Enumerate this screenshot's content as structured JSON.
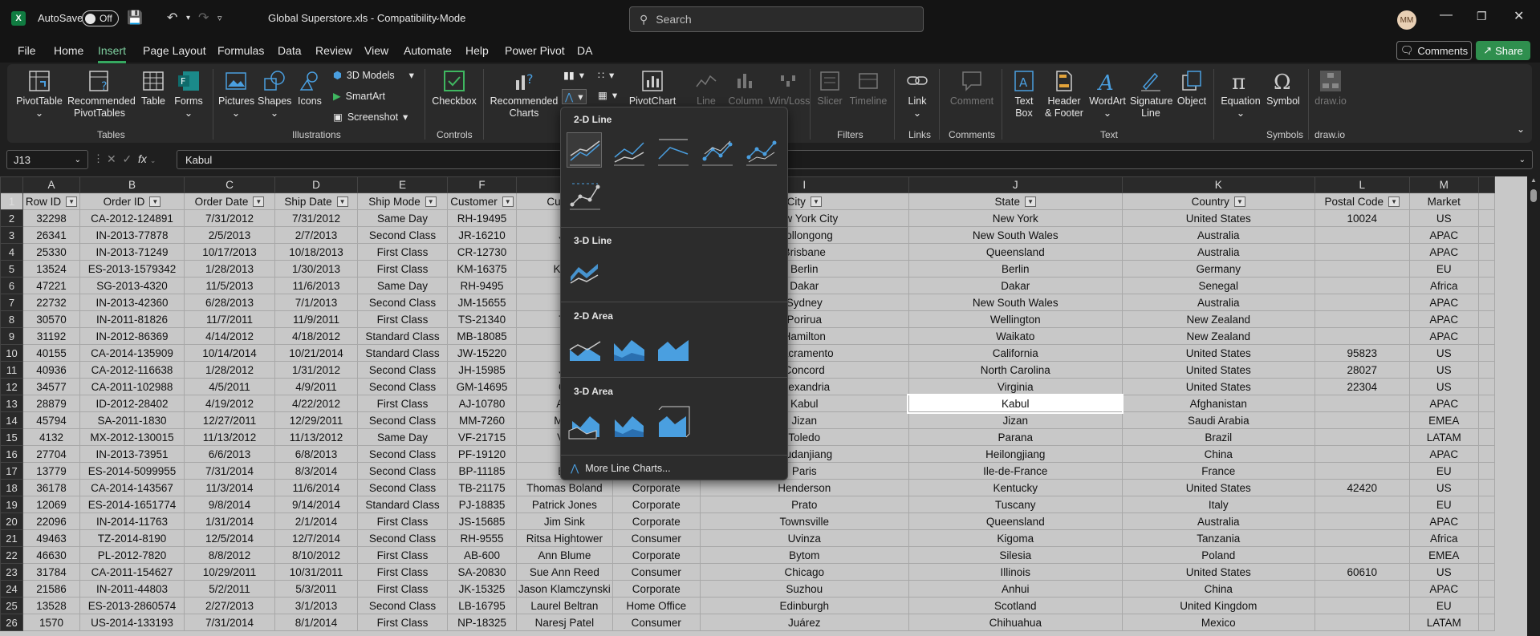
{
  "app": {
    "logo": "X",
    "autosave_label": "AutoSave",
    "autosave_state": "Off",
    "doc_title": "Global Superstore.xls  -  Compatibility Mode",
    "search_placeholder": "Search",
    "avatar": "MM"
  },
  "menu": [
    "File",
    "Home",
    "Insert",
    "Page Layout",
    "Formulas",
    "Data",
    "Review",
    "View",
    "Automate",
    "Help",
    "Power Pivot",
    "DA"
  ],
  "menu_active": "Insert",
  "actions": {
    "comments": "Comments",
    "share": "Share"
  },
  "ribbon": {
    "pivottable": "PivotTable",
    "recommended_pivottables": "Recommended PivotTables",
    "table": "Table",
    "forms": "Forms",
    "pictures": "Pictures",
    "shapes": "Shapes",
    "icons": "Icons",
    "models3d": "3D Models",
    "smartart": "SmartArt",
    "screenshot": "Screenshot",
    "checkbox": "Checkbox",
    "recommended_charts": "Recommended Charts",
    "pivotchart": "PivotChart",
    "spark_line": "Line",
    "spark_column": "Column",
    "spark_winloss": "Win/Loss",
    "slicer": "Slicer",
    "timeline": "Timeline",
    "link": "Link",
    "comment": "Comment",
    "textbox": "Text Box",
    "header_footer": "Header & Footer",
    "wordart": "WordArt",
    "signature_line": "Signature Line",
    "object": "Object",
    "equation": "Equation",
    "symbol": "Symbol",
    "drawio": "draw.io",
    "groups": {
      "tables": "Tables",
      "illustrations": "Illustrations",
      "controls": "Controls",
      "filters": "Filters",
      "links": "Links",
      "comments": "Comments",
      "text": "Text",
      "symbols": "Symbols",
      "drawio": "draw.io"
    }
  },
  "formula_bar": {
    "cell": "J13",
    "value": "Kabul"
  },
  "dropdown": {
    "sec_2d_line": "2-D Line",
    "sec_3d_line": "3-D Line",
    "sec_2d_area": "2-D Area",
    "sec_3d_area": "3-D Area",
    "more": "More Line Charts..."
  },
  "columns": [
    "A",
    "B",
    "C",
    "D",
    "E",
    "F",
    "G",
    "H",
    "I",
    "J",
    "K",
    "L",
    "M"
  ],
  "headers": [
    "Row ID",
    "Order ID",
    "Order Date",
    "Ship Date",
    "Ship Mode",
    "Customer",
    "Cus",
    "",
    "City",
    "State",
    "Country",
    "Postal Code",
    "Market"
  ],
  "rows": [
    [
      "32298",
      "CA-2012-124891",
      "7/31/2012",
      "7/31/2012",
      "Same Day",
      "RH-19495",
      "R",
      "",
      "New York City",
      "New York",
      "United States",
      "10024",
      "US"
    ],
    [
      "26341",
      "IN-2013-77878",
      "2/5/2013",
      "2/7/2013",
      "Second Class",
      "JR-16210",
      "Ju",
      "",
      "Wollongong",
      "New South Wales",
      "Australia",
      "",
      "APAC"
    ],
    [
      "25330",
      "IN-2013-71249",
      "10/17/2013",
      "10/18/2013",
      "First Class",
      "CR-12730",
      "C",
      "",
      "Brisbane",
      "Queensland",
      "Australia",
      "",
      "APAC"
    ],
    [
      "13524",
      "ES-2013-1579342",
      "1/28/2013",
      "1/30/2013",
      "First Class",
      "KM-16375",
      "Kath",
      "",
      "Berlin",
      "Berlin",
      "Germany",
      "",
      "EU"
    ],
    [
      "47221",
      "SG-2013-4320",
      "11/5/2013",
      "11/6/2013",
      "Same Day",
      "RH-9495",
      "R",
      "",
      "Dakar",
      "Dakar",
      "Senegal",
      "",
      "Africa"
    ],
    [
      "22732",
      "IN-2013-42360",
      "6/28/2013",
      "7/1/2013",
      "Second Class",
      "JM-15655",
      "Ji",
      "",
      "Sydney",
      "New South Wales",
      "Australia",
      "",
      "APAC"
    ],
    [
      "30570",
      "IN-2011-81826",
      "11/7/2011",
      "11/9/2011",
      "First Class",
      "TS-21340",
      "To",
      "",
      "Porirua",
      "Wellington",
      "New Zealand",
      "",
      "APAC"
    ],
    [
      "31192",
      "IN-2012-86369",
      "4/14/2012",
      "4/18/2012",
      "Standard Class",
      "MB-18085",
      "M",
      "",
      "Hamilton",
      "Waikato",
      "New Zealand",
      "",
      "APAC"
    ],
    [
      "40155",
      "CA-2014-135909",
      "10/14/2014",
      "10/21/2014",
      "Standard Class",
      "JW-15220",
      "J",
      "",
      "Sacramento",
      "California",
      "United States",
      "95823",
      "US"
    ],
    [
      "40936",
      "CA-2012-116638",
      "1/28/2012",
      "1/31/2012",
      "Second Class",
      "JH-15985",
      "Jo",
      "",
      "Concord",
      "North Carolina",
      "United States",
      "28027",
      "US"
    ],
    [
      "34577",
      "CA-2011-102988",
      "4/5/2011",
      "4/9/2011",
      "Second Class",
      "GM-14695",
      "Gr",
      "",
      "Alexandria",
      "Virginia",
      "United States",
      "22304",
      "US"
    ],
    [
      "28879",
      "ID-2012-28402",
      "4/19/2012",
      "4/22/2012",
      "First Class",
      "AJ-10780",
      "Ant",
      "",
      "Kabul",
      "Kabul",
      "Afghanistan",
      "",
      "APAC"
    ],
    [
      "45794",
      "SA-2011-1830",
      "12/27/2011",
      "12/29/2011",
      "Second Class",
      "MM-7260",
      "Mag",
      "",
      "Jizan",
      "Jizan",
      "Saudi Arabia",
      "",
      "EMEA"
    ],
    [
      "4132",
      "MX-2012-130015",
      "11/13/2012",
      "11/13/2012",
      "Same Day",
      "VF-21715",
      "Vic",
      "",
      "Toledo",
      "Parana",
      "Brazil",
      "",
      "LATAM"
    ],
    [
      "27704",
      "IN-2013-73951",
      "6/6/2013",
      "6/8/2013",
      "Second Class",
      "PF-19120",
      "P",
      "",
      "Mudanjiang",
      "Heilongjiang",
      "China",
      "",
      "APAC"
    ],
    [
      "13779",
      "ES-2014-5099955",
      "7/31/2014",
      "8/3/2014",
      "Second Class",
      "BP-11185",
      "Be",
      "",
      "Paris",
      "Ile-de-France",
      "France",
      "",
      "EU"
    ],
    [
      "36178",
      "CA-2014-143567",
      "11/3/2014",
      "11/6/2014",
      "Second Class",
      "TB-21175",
      "Thomas Boland",
      "Corporate",
      "Henderson",
      "Kentucky",
      "United States",
      "42420",
      "US"
    ],
    [
      "12069",
      "ES-2014-1651774",
      "9/8/2014",
      "9/14/2014",
      "Standard Class",
      "PJ-18835",
      "Patrick Jones",
      "Corporate",
      "Prato",
      "Tuscany",
      "Italy",
      "",
      "EU"
    ],
    [
      "22096",
      "IN-2014-11763",
      "1/31/2014",
      "2/1/2014",
      "First Class",
      "JS-15685",
      "Jim Sink",
      "Corporate",
      "Townsville",
      "Queensland",
      "Australia",
      "",
      "APAC"
    ],
    [
      "49463",
      "TZ-2014-8190",
      "12/5/2014",
      "12/7/2014",
      "Second Class",
      "RH-9555",
      "Ritsa Hightower",
      "Consumer",
      "Uvinza",
      "Kigoma",
      "Tanzania",
      "",
      "Africa"
    ],
    [
      "46630",
      "PL-2012-7820",
      "8/8/2012",
      "8/10/2012",
      "First Class",
      "AB-600",
      "Ann Blume",
      "Corporate",
      "Bytom",
      "Silesia",
      "Poland",
      "",
      "EMEA"
    ],
    [
      "31784",
      "CA-2011-154627",
      "10/29/2011",
      "10/31/2011",
      "First Class",
      "SA-20830",
      "Sue Ann Reed",
      "Consumer",
      "Chicago",
      "Illinois",
      "United States",
      "60610",
      "US"
    ],
    [
      "21586",
      "IN-2011-44803",
      "5/2/2011",
      "5/3/2011",
      "First Class",
      "JK-15325",
      "Jason Klamczynski",
      "Corporate",
      "Suzhou",
      "Anhui",
      "China",
      "",
      "APAC"
    ],
    [
      "13528",
      "ES-2013-2860574",
      "2/27/2013",
      "3/1/2013",
      "Second Class",
      "LB-16795",
      "Laurel Beltran",
      "Home Office",
      "Edinburgh",
      "Scotland",
      "United Kingdom",
      "",
      "EU"
    ],
    [
      "1570",
      "US-2014-133193",
      "7/31/2014",
      "8/1/2014",
      "First Class",
      "NP-18325",
      "Naresj Patel",
      "Consumer",
      "Juárez",
      "Chihuahua",
      "Mexico",
      "",
      "LATAM"
    ]
  ]
}
